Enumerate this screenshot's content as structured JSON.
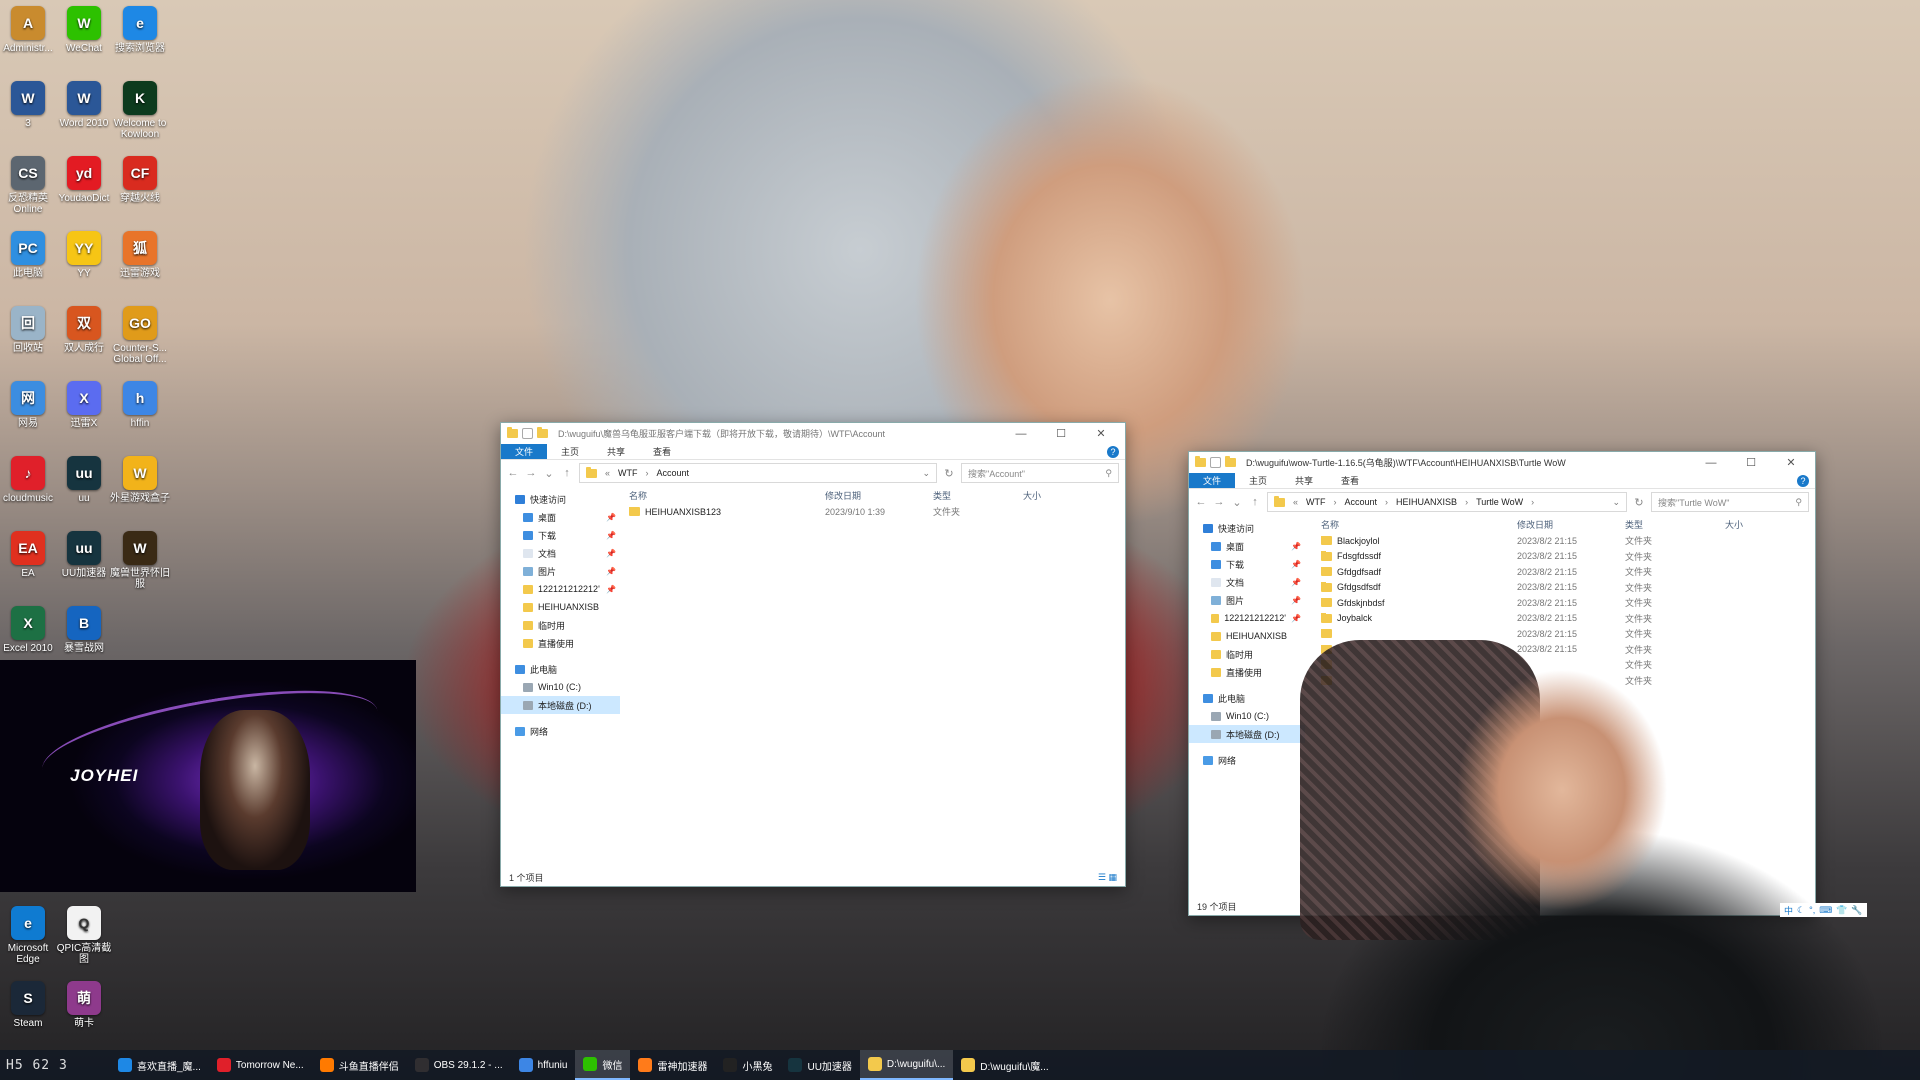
{
  "desktop": {
    "icons": [
      {
        "label": "Administr...",
        "color": "#c98b2e",
        "glyph": "A"
      },
      {
        "label": "WeChat",
        "color": "#2dc100",
        "glyph": "W"
      },
      {
        "label": "搜索浏览器",
        "color": "#1e88e5",
        "glyph": "e"
      },
      {
        "label": "3",
        "color": "#2b5797",
        "glyph": "W"
      },
      {
        "label": "Word 2010",
        "color": "#2b5797",
        "glyph": "W"
      },
      {
        "label": "Welcome to Kowloon",
        "color": "#0d3b1e",
        "glyph": "K"
      },
      {
        "label": "反恐精英Online",
        "color": "#5c6670",
        "glyph": "CS"
      },
      {
        "label": "YoudaoDict",
        "color": "#e31b23",
        "glyph": "yd"
      },
      {
        "label": "穿越火线",
        "color": "#d92b1f",
        "glyph": "CF"
      },
      {
        "label": "此电脑",
        "color": "#2f8fe0",
        "glyph": "PC"
      },
      {
        "label": "YY",
        "color": "#f6c515",
        "glyph": "YY"
      },
      {
        "label": "迅雷游戏",
        "color": "#e8742a",
        "glyph": "狐"
      },
      {
        "label": "回收站",
        "color": "#9ab4c8",
        "glyph": "回"
      },
      {
        "label": "双人成行",
        "color": "#d8561f",
        "glyph": "双"
      },
      {
        "label": "Counter-S... Global Off...",
        "color": "#e09b1a",
        "glyph": "GO"
      },
      {
        "label": "网易",
        "color": "#3c8de0",
        "glyph": "网"
      },
      {
        "label": "迅雷X",
        "color": "#5b6cf0",
        "glyph": "X"
      },
      {
        "label": "hffin",
        "color": "#3d86e5",
        "glyph": "h"
      },
      {
        "label": "cloudmusic",
        "color": "#e0202a",
        "glyph": "♪"
      },
      {
        "label": "uu",
        "color": "#16343f",
        "glyph": "uu"
      },
      {
        "label": "外星游戏盒子",
        "color": "#f2b31a",
        "glyph": "W"
      },
      {
        "label": "EA",
        "color": "#e0301f",
        "glyph": "EA"
      },
      {
        "label": "UU加速器",
        "color": "#16343f",
        "glyph": "uu"
      },
      {
        "label": "魔兽世界怀旧服",
        "color": "#3a2a15",
        "glyph": "W"
      },
      {
        "label": "Excel 2010",
        "color": "#1d7044",
        "glyph": "X"
      },
      {
        "label": "暴雪战网",
        "color": "#1565c0",
        "glyph": "B"
      },
      {
        "label": "Microsoft Edge",
        "color": "#0f7bd1",
        "glyph": "e"
      },
      {
        "label": "QPIC高清截图",
        "color": "#f2f2f2",
        "glyph": "Q"
      },
      {
        "label": "Steam",
        "color": "#1b2838",
        "glyph": "S"
      },
      {
        "label": "萌卡",
        "color": "#8e3a8c",
        "glyph": "萌"
      }
    ],
    "promo_logo": "JOYHEI"
  },
  "window1": {
    "title": "D:\\wuguifu\\魔兽乌龟服亚服客户端下载（即将开放下载，敬请期待）\\WTF\\Account",
    "tabs": [
      "文件",
      "主页",
      "共享",
      "查看"
    ],
    "breadcrumb": [
      "WTF",
      "Account"
    ],
    "search_placeholder": "搜索\"Account\"",
    "columns": [
      "名称",
      "修改日期",
      "类型",
      "大小"
    ],
    "files": [
      {
        "name": "HEIHUANXISB123",
        "date": "2023/9/10 1:39",
        "type": "文件夹",
        "size": ""
      }
    ],
    "status": "1 个项目"
  },
  "window2": {
    "title": "D:\\wuguifu\\wow-Turtle-1.16.5(乌龟服)\\WTF\\Account\\HEIHUANXISB\\Turtle WoW",
    "tabs": [
      "文件",
      "主页",
      "共享",
      "查看"
    ],
    "breadcrumb": [
      "WTF",
      "Account",
      "HEIHUANXISB",
      "Turtle WoW"
    ],
    "search_placeholder": "搜索\"Turtle WoW\"",
    "columns": [
      "名称",
      "修改日期",
      "类型",
      "大小"
    ],
    "files": [
      {
        "name": "Blackjoylol",
        "date": "2023/8/2 21:15",
        "type": "文件夹"
      },
      {
        "name": "Fdsgfdssdf",
        "date": "2023/8/2 21:15",
        "type": "文件夹"
      },
      {
        "name": "Gfdgdfsadf",
        "date": "2023/8/2 21:15",
        "type": "文件夹"
      },
      {
        "name": "Gfdgsdfsdf",
        "date": "2023/8/2 21:15",
        "type": "文件夹"
      },
      {
        "name": "Gfdskjnbdsf",
        "date": "2023/8/2 21:15",
        "type": "文件夹"
      },
      {
        "name": "Joybalck",
        "date": "2023/8/2 21:15",
        "type": "文件夹"
      },
      {
        "name": "",
        "date": "2023/8/2 21:15",
        "type": "文件夹"
      },
      {
        "name": "",
        "date": "2023/8/2 21:15",
        "type": "文件夹"
      },
      {
        "name": "",
        "date": "",
        "type": "文件夹"
      },
      {
        "name": "",
        "date": "",
        "type": "文件夹"
      }
    ],
    "status": "19 个项目"
  },
  "navpane": {
    "quick_access": "快速访问",
    "items": [
      {
        "label": "桌面",
        "pinned": true,
        "color": "#3e8ee0"
      },
      {
        "label": "下载",
        "pinned": true,
        "color": "#3e8ee0"
      },
      {
        "label": "文档",
        "pinned": true,
        "color": "#dfe6ef"
      },
      {
        "label": "图片",
        "pinned": true,
        "color": "#7fb0d8"
      },
      {
        "label": "122121212212'",
        "pinned": true,
        "color": "#f3c94c"
      },
      {
        "label": "HEIHUANXISB",
        "pinned": false,
        "color": "#f3c94c"
      },
      {
        "label": "临时用",
        "pinned": false,
        "color": "#f3c94c"
      },
      {
        "label": "直播使用",
        "pinned": false,
        "color": "#f3c94c"
      }
    ],
    "this_pc": "此电脑",
    "drives": [
      "Win10 (C:)",
      "本地磁盘 (D:)"
    ],
    "network": "网络"
  },
  "taskbar": {
    "clock": "H5 62 3",
    "tasks": [
      {
        "label": "喜欢直播_魔...",
        "color": "#1e88e5"
      },
      {
        "label": "Tomorrow Ne...",
        "color": "#e0202a"
      },
      {
        "label": "斗鱼直播伴侣",
        "color": "#ff7a00"
      },
      {
        "label": "OBS 29.1.2 - ...",
        "color": "#302e31"
      },
      {
        "label": "hffuniu",
        "color": "#3d86e5"
      },
      {
        "label": "微信",
        "color": "#2dc100"
      },
      {
        "label": "雷神加速器",
        "color": "#ff7b1a"
      },
      {
        "label": "小黑兔",
        "color": "#222222"
      },
      {
        "label": "UU加速器",
        "color": "#16343f"
      },
      {
        "label": "D:\\wuguifu\\...",
        "color": "#f3c94c"
      },
      {
        "label": "D:\\wuguifu\\魔...",
        "color": "#f3c94c"
      }
    ]
  },
  "tray": {
    "ime": "中"
  }
}
